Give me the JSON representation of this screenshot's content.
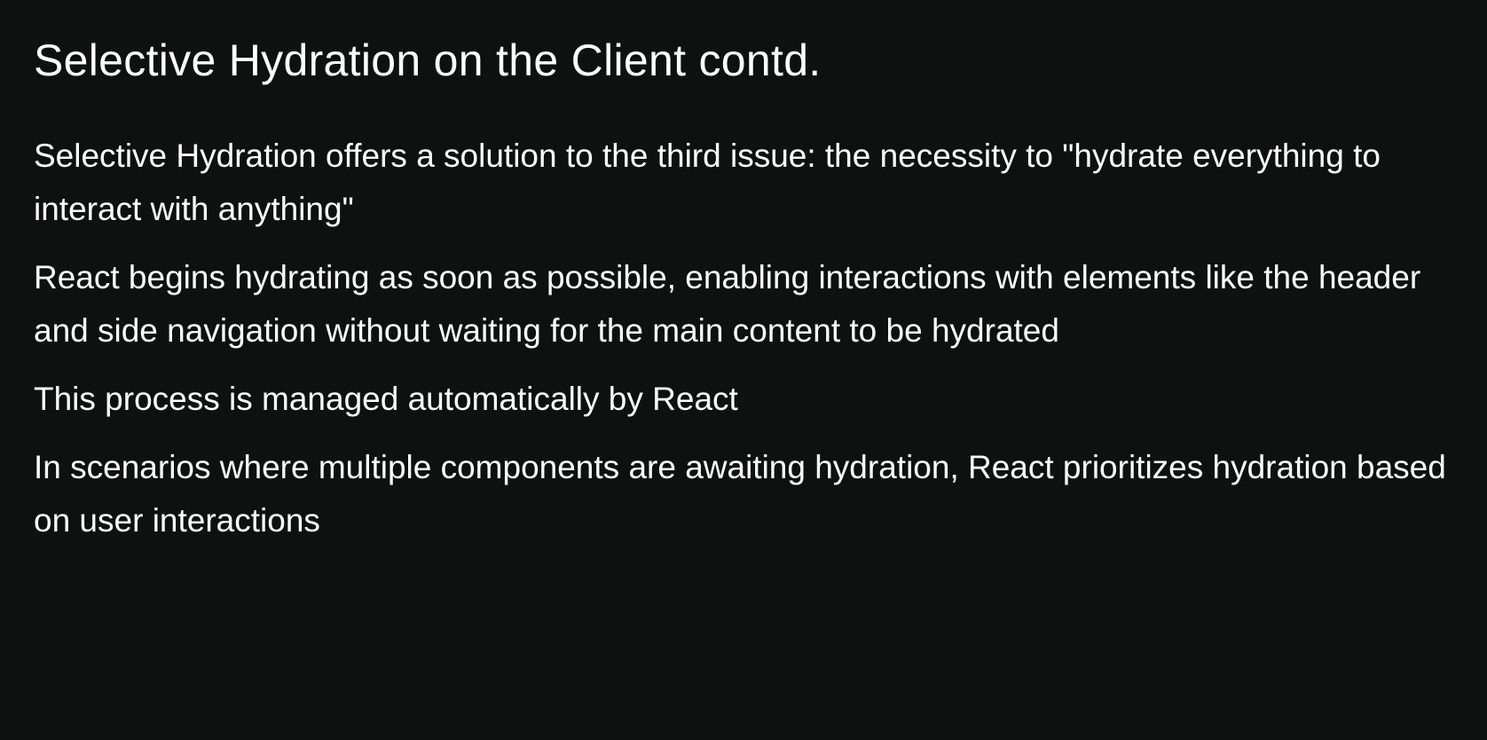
{
  "slide": {
    "title": "Selective Hydration on the Client contd.",
    "points": [
      "Selective Hydration offers a solution to the third issue: the necessity to \"hydrate everything to interact with anything\"",
      "React begins hydrating as soon as possible, enabling interactions with elements like the header and side navigation without waiting for the main content to be hydrated",
      "This process is managed automatically by React",
      "In scenarios where multiple components are awaiting hydration, React prioritizes hydration based on user interactions"
    ]
  },
  "colors": {
    "background": "#0f1110",
    "text": "#ffffff"
  }
}
